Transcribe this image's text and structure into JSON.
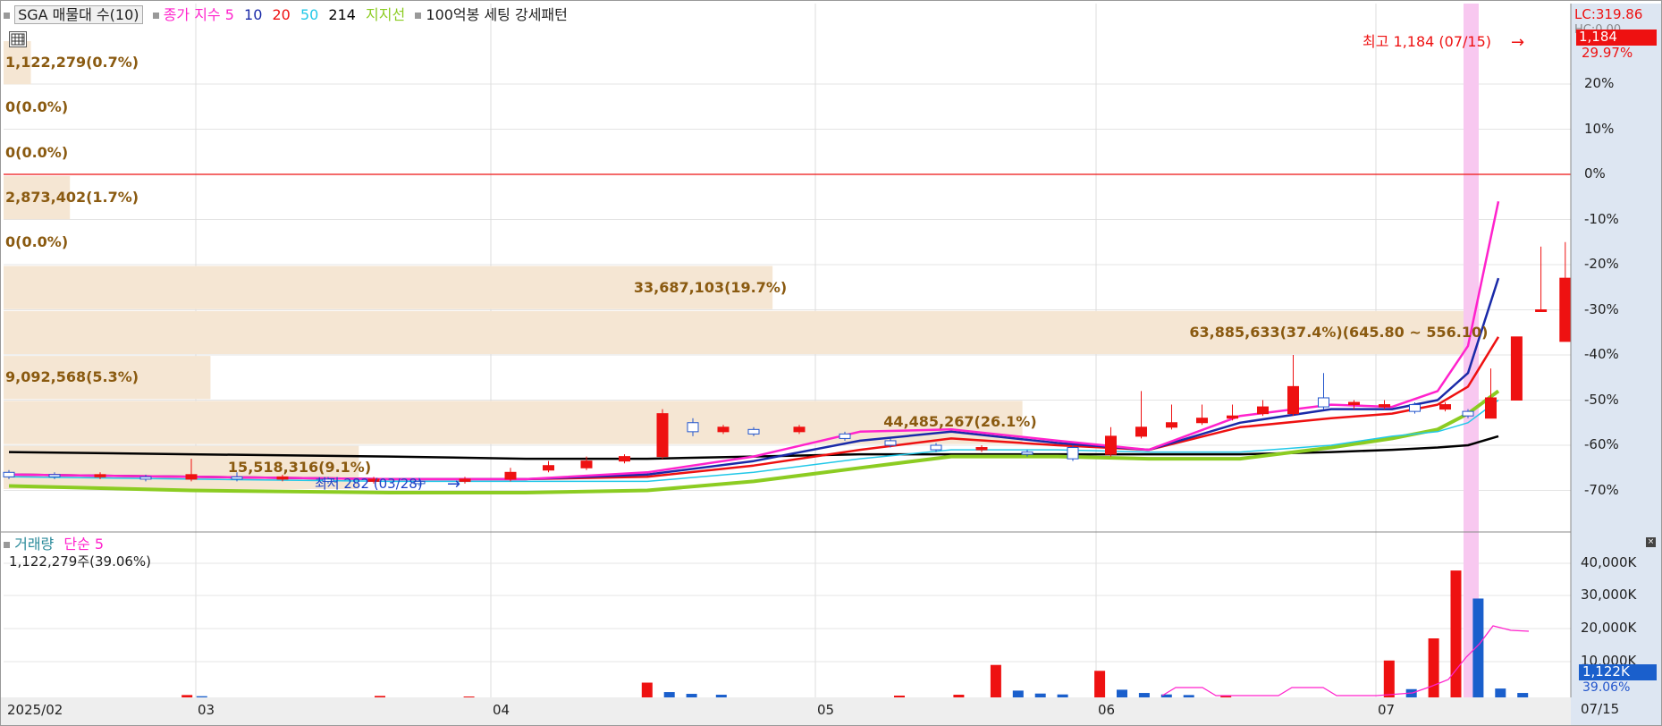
{
  "legend": {
    "title": "SGA 매물대 수(10)",
    "price_prefix": "종가 지수",
    "ma_periods": [
      "5",
      "10",
      "20",
      "50",
      "214"
    ],
    "support_label": "지지선",
    "pattern_label": "100억봉 세팅 강세패턴"
  },
  "colors": {
    "ma5": "#ff22cc",
    "ma10": "#1a2aa8",
    "ma20": "#ee1111",
    "ma50": "#22c8e8",
    "ma214": "#000000",
    "support": "#8ccc22",
    "up": "#ee1111",
    "down": "#2255cc",
    "profile": "#f5e6d3",
    "profile_text": "#8a5a10",
    "highlight": "#f8c8f0",
    "axis_bg": "#dde6f2"
  },
  "profile": [
    {
      "label": "1,122,279(0.7%)",
      "share": 0.7
    },
    {
      "label": "0(0.0%)",
      "share": 0.0
    },
    {
      "label": "0(0.0%)",
      "share": 0.0
    },
    {
      "label": "2,873,402(1.7%)",
      "share": 1.7
    },
    {
      "label": "0(0.0%)",
      "share": 0.0
    },
    {
      "label": "33,687,103(19.7%)",
      "share": 19.7
    },
    {
      "label": "63,885,633(37.4%)(645.80 ~ 556.10)",
      "share": 37.4
    },
    {
      "label": "9,092,568(5.3%)",
      "share": 5.3
    },
    {
      "label": "44,485,267(26.1%)",
      "share": 26.1
    },
    {
      "label": "15,518,316(9.1%)",
      "share": 9.1
    }
  ],
  "price_axis": {
    "ticks": [
      "20%",
      "10%",
      "0%",
      "-10%",
      "-20%",
      "-30%",
      "-40%",
      "-50%",
      "-60%",
      "-70%"
    ],
    "lc_label": "LC:319.86",
    "hc_label": "HC:0.00",
    "current_price": "1,184",
    "current_pct": "29.97%"
  },
  "annotations": {
    "high": "최고 1,184 (07/15)",
    "low": "최저 282 (03/28)"
  },
  "volume": {
    "title": "거래량",
    "ma_label": "단순 5",
    "value": "1,122,279주(39.06%)",
    "ticks": [
      "40,000K",
      "30,000K",
      "20,000K",
      "10,000K"
    ],
    "current": "1,122K",
    "current_pct": "39.06%"
  },
  "x_axis": {
    "labels": [
      "2025/02",
      "03",
      "04",
      "05",
      "06",
      "07"
    ],
    "current": "07/15"
  },
  "chart_data": {
    "type": "candlestick",
    "title": "SGA 매물대 수(10)",
    "y_unit": "% from base 0%",
    "ylim": [
      -75,
      30
    ],
    "months": [
      "2025/02",
      "03",
      "04",
      "05",
      "06",
      "07"
    ],
    "close_series_pct": [
      -66.5,
      -67,
      -67.5,
      -67,
      -66.5,
      -64,
      -62,
      -53,
      -57,
      -56,
      -60,
      -61,
      -62,
      -61,
      -58,
      -55,
      -51,
      -52,
      -52,
      -52,
      -36,
      -30,
      -23
    ],
    "high_pct": 27.5,
    "high_label": "1,184 (07/15)",
    "low_label": "282 (03/28)",
    "volume_ylim_k": [
      0,
      45000
    ],
    "volume_spikes_k": [
      {
        "date": "04 late",
        "value": 5000
      },
      {
        "date": "06 early",
        "value": 11000
      },
      {
        "date": "06 late",
        "value": 9000
      },
      {
        "date": "07 early",
        "value": 12500
      },
      {
        "date": "07 mid",
        "value": 20000
      },
      {
        "date": "07/14",
        "value": 43000
      },
      {
        "date": "07/15",
        "value": 33500
      }
    ],
    "grid": true
  }
}
